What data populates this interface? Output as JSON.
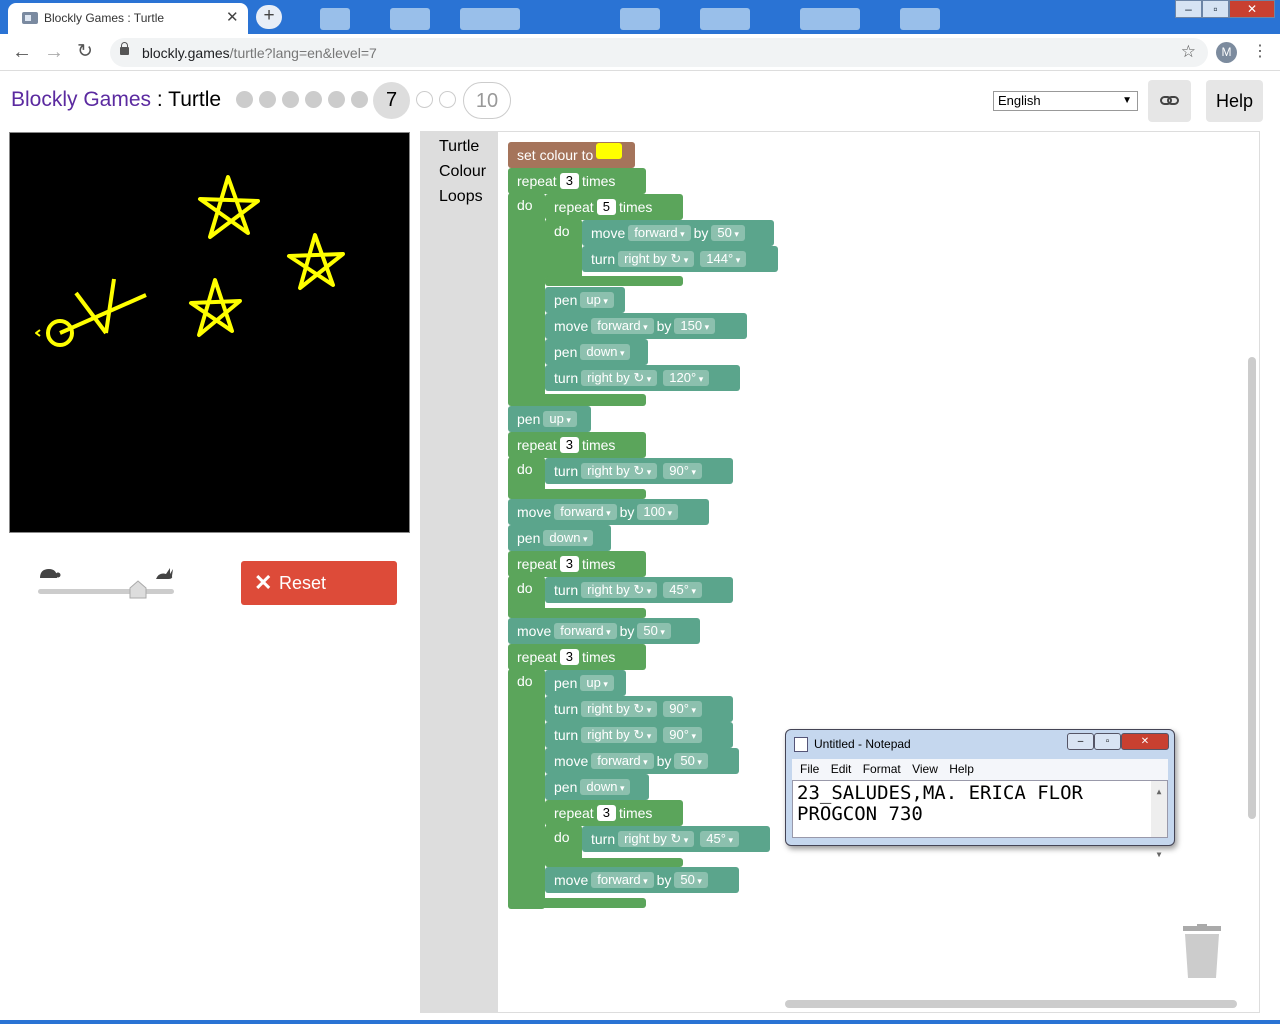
{
  "browser": {
    "tab_title": "Blockly Games : Turtle",
    "url_host": "blockly.games",
    "url_path": "/turtle?lang=en&level=7",
    "avatar_letter": "M"
  },
  "header": {
    "brand": "Blockly Games",
    "separator": " : ",
    "game": "Turtle",
    "current_level": "7",
    "last_level": "10",
    "language": "English",
    "help_label": "Help"
  },
  "controls": {
    "reset_label": "Reset",
    "speed_fraction": 0.77
  },
  "categories": [
    "Turtle",
    "Colour",
    "Loops"
  ],
  "blocks": {
    "set_colour": "set colour to",
    "repeat": "repeat",
    "times": "times",
    "do": "do",
    "move": "move",
    "turn": "turn",
    "by": "by",
    "pen": "pen",
    "forward": "forward",
    "right_by": "right by ↻",
    "up": "up",
    "down": "down",
    "n3": "3",
    "n5": "5",
    "n50": "50",
    "n100": "100",
    "n150": "150",
    "a144": "144°",
    "a120": "120°",
    "a90": "90°",
    "a45": "45°"
  },
  "notepad": {
    "title": "Untitled - Notepad",
    "menu": [
      "File",
      "Edit",
      "Format",
      "View",
      "Help"
    ],
    "line1": "23_SALUDES,MA. ERICA FLOR",
    "line2": "PROGCON 730"
  },
  "colors": {
    "pen": "#ffff00",
    "loop_block": "#5ba55b",
    "turtle_block": "#5ba58c",
    "colour_block": "#a5745b",
    "reset": "#dd4b39"
  }
}
